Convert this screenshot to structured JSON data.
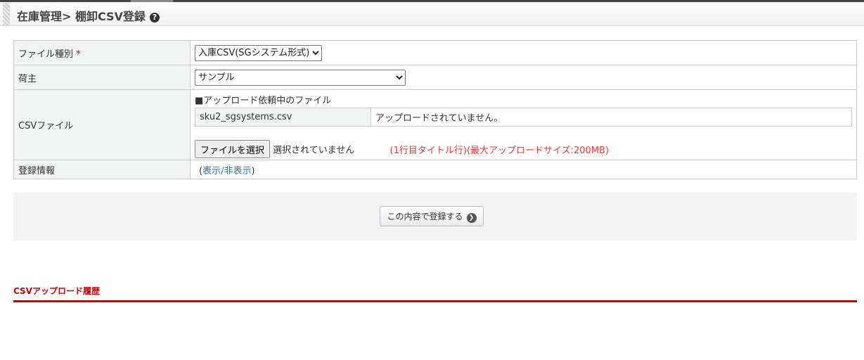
{
  "header": {
    "title": "在庫管理> 棚卸CSV登録",
    "help_icon": "question-circle-icon"
  },
  "form": {
    "file_type": {
      "label": "ファイル種別",
      "required_mark": "*",
      "value": "入庫CSV(SGシステム形式)"
    },
    "owner": {
      "label": "荷主",
      "value": "サンプル"
    },
    "csv": {
      "label": "CSVファイル",
      "pending_heading": "■アップロード依頼中のファイル",
      "pending_file": "sku2_sgsystems.csv",
      "pending_status": "アップロードされていません。",
      "choose_button": "ファイルを選択",
      "chosen": "選択されていません",
      "note": "(1行目タイトル行)(最大アップロードサイズ:200MB)"
    },
    "reg_info": {
      "label": "登録情報",
      "open": "(",
      "link": "表示/非表示",
      "close": ")"
    }
  },
  "submit_label": "この内容で登録する",
  "history_title": "CSVアップロード履歴"
}
